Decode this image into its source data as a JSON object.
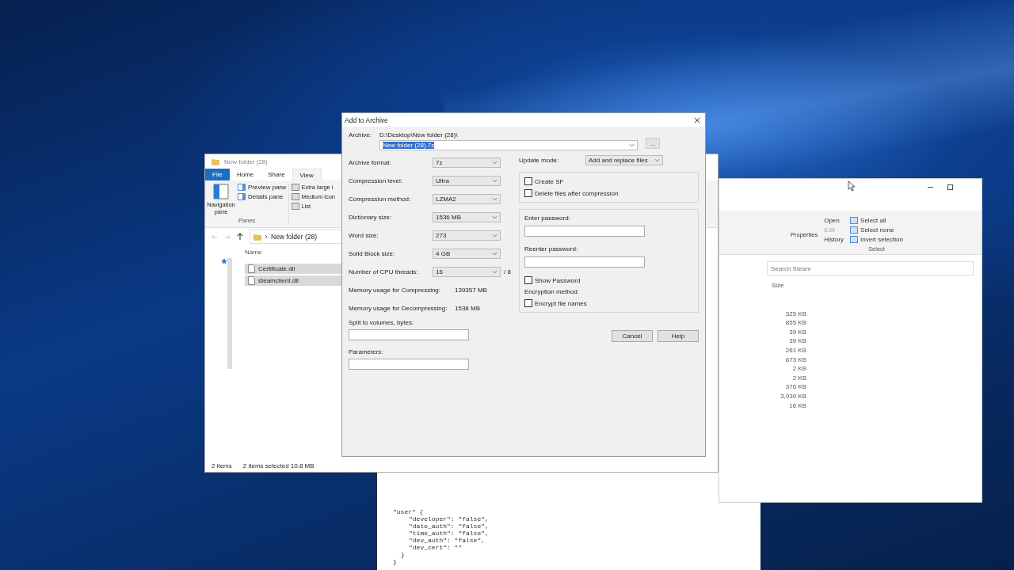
{
  "text_window": {
    "opening": "\"user\" {",
    "entries": [
      "\"developer\": \"false\",",
      "\"date_auth\": \"false\",",
      "\"time_auth\": \"false\",",
      "\"dev_auth\": \"false\",",
      "\"dev_cert\": \"\""
    ],
    "closing": "}",
    "final": "}"
  },
  "explorer": {
    "title": "New folder (28)",
    "tabs": [
      {
        "label": "File",
        "kind": "file",
        "selected": false
      },
      {
        "label": "Home",
        "kind": "tab",
        "selected": false
      },
      {
        "label": "Share",
        "kind": "tab",
        "selected": false
      },
      {
        "label": "View",
        "kind": "tab",
        "selected": true
      }
    ],
    "navigation_pane": "Navigation pane",
    "pane_options": [
      "Preview pane",
      "Details pane"
    ],
    "group_label": "Panes",
    "layouts": [
      "Extra large i",
      "Medium icon",
      "List"
    ],
    "address": "New folder (28)",
    "column": "Name",
    "files": [
      {
        "name": "Certificate.dll",
        "selected": true
      },
      {
        "name": "steamclient.dll",
        "selected": true
      }
    ],
    "status": {
      "count": "2 items",
      "selection": "2 items selected  10.8 MB"
    }
  },
  "steam_window": {
    "ribbon": {
      "open_items": [
        {
          "label": "Open",
          "disabled": false
        },
        {
          "label": "Edit",
          "disabled": true
        },
        {
          "label": "History",
          "disabled": false
        }
      ],
      "properties": "Properties",
      "select_items": [
        "Select all",
        "Select none",
        "Invert selection"
      ],
      "select_label": "Select"
    },
    "search": {
      "placeholder": "Search Steam"
    },
    "column": "Size",
    "sizes": [
      "325 KB",
      "855 KB",
      "39 KB",
      "39 KB",
      "261 KB",
      "673 KB",
      "2 KB",
      "2 KB",
      "376 KB",
      "3,030 KB",
      "16 KB"
    ]
  },
  "dialog": {
    "title": "Add to Archive",
    "archive_label": "Archive:",
    "archive_path": "D:\\Desktop\\New folder (28)\\",
    "archive_name": "New folder (28).7z",
    "browse": "...",
    "settings": [
      {
        "kind": "select",
        "label": "Archive format:",
        "value": "7z"
      },
      {
        "kind": "select",
        "label": "Compression level:",
        "value": "Ultra"
      },
      {
        "kind": "select",
        "label": "Compression method:",
        "value": "LZMA2"
      },
      {
        "kind": "select",
        "label": "Dictionary size:",
        "value": "1536 MB"
      },
      {
        "kind": "select",
        "label": "Word size:",
        "value": "273"
      },
      {
        "kind": "select",
        "label": "Solid Block size:",
        "value": "4 GB"
      },
      {
        "kind": "threads",
        "label": "Number of CPU threads:",
        "value": "16",
        "reading": "/ 8"
      },
      {
        "kind": "reading",
        "label": "Memory usage for Compressing:",
        "value": "139357 MB"
      },
      {
        "kind": "reading",
        "label": "Memory usage for Decompressing:",
        "value": "1538 MB"
      }
    ],
    "split_label": "Split to volumes, bytes:",
    "parameters_label": "Parameters:",
    "update_label": "Update mode:",
    "update_value": "Add and replace files",
    "options": [
      {
        "label": "Create SF",
        "checked": false
      },
      {
        "label": "Delete files after compression",
        "checked": false
      }
    ],
    "encryption": {
      "enter": "Enter password:",
      "reenter": "Reenter password:",
      "show": {
        "label": "Show Password",
        "checked": false
      },
      "method": "Encryption method:",
      "names": {
        "label": "Encrypt file names",
        "checked": false
      }
    },
    "buttons": [
      "Cancel",
      "Help"
    ]
  }
}
